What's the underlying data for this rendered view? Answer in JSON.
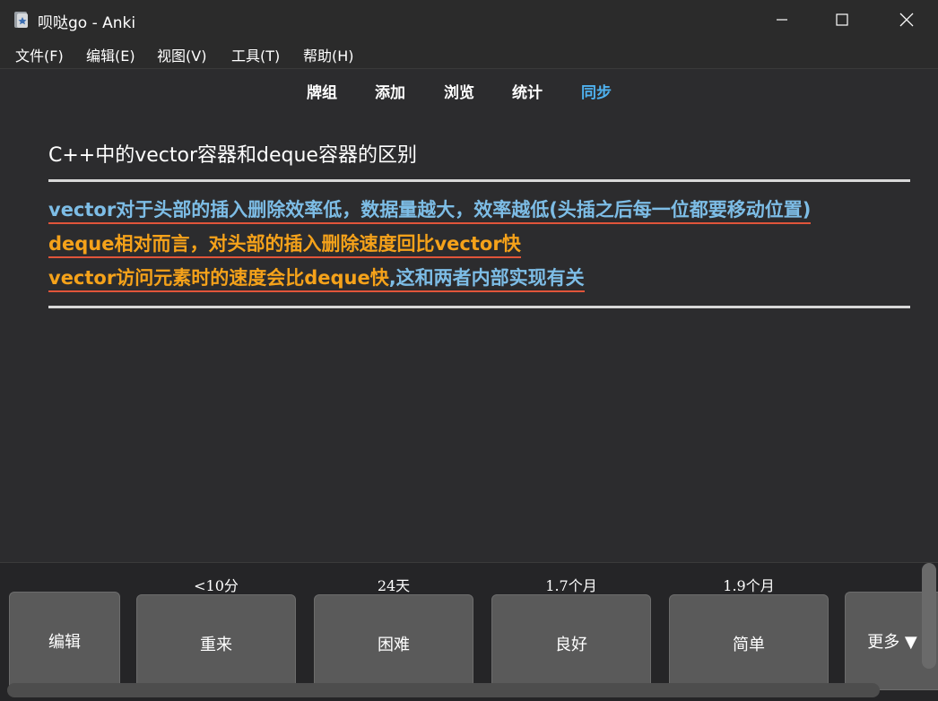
{
  "window": {
    "title": "呗哒go - Anki",
    "minimize_icon": "minimize-icon",
    "maximize_icon": "maximize-icon",
    "close_icon": "close-icon"
  },
  "menu": {
    "items": [
      "文件(F)",
      "编辑(E)",
      "视图(V)",
      "工具(T)",
      "帮助(H)"
    ]
  },
  "toolbar": {
    "links": [
      "牌组",
      "添加",
      "浏览",
      "统计",
      "同步"
    ],
    "sync_color": "#4fb2f0"
  },
  "card": {
    "question": "C++中的vector容器和deque容器的区别",
    "answer": {
      "line1": "vector对于头部的插入删除效率低，数据量越大，效率越低(头插之后每一位都要移动位置)",
      "line2": "deque相对而言，对头部的插入删除速度回比vector快",
      "line3_orange": "vector访问元素时的速度会比deque快",
      "line3_blue": ",这和两者内部实现有关"
    },
    "colors": {
      "blue": "#7dbde6",
      "orange": "#f5a21a",
      "underline": "#e0553a"
    }
  },
  "review": {
    "edit_label": "编辑",
    "more_label": "更多 ▼",
    "buttons": [
      {
        "label": "重来",
        "interval": "<10分"
      },
      {
        "label": "困难",
        "interval": "24天"
      },
      {
        "label": "良好",
        "interval": "1.7个月"
      },
      {
        "label": "简单",
        "interval": "1.9个月"
      }
    ]
  }
}
